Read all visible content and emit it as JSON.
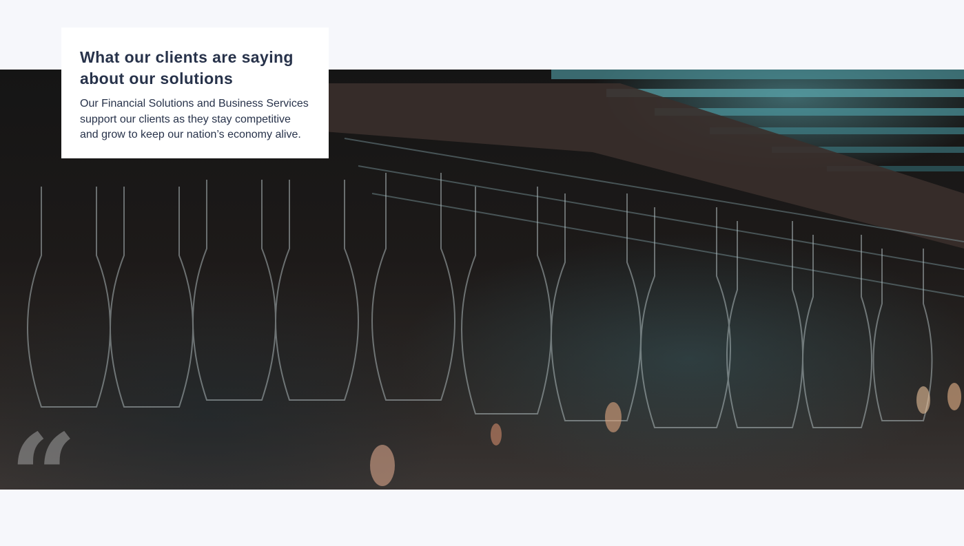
{
  "intro": {
    "title": "What our clients are saying about our solutions",
    "text": "Our Financial Solutions and Business Services support our clients as they stay competitive and grow to keep our nation’s economy alive."
  },
  "hero": {
    "image": "wine-glasses-hanging-photo",
    "quote_glyph": "“"
  },
  "colors": {
    "page_background": "#f6f7fb",
    "card_background": "#ffffff",
    "heading_text": "#27324a",
    "accent_teal": "#6ec8d2"
  }
}
